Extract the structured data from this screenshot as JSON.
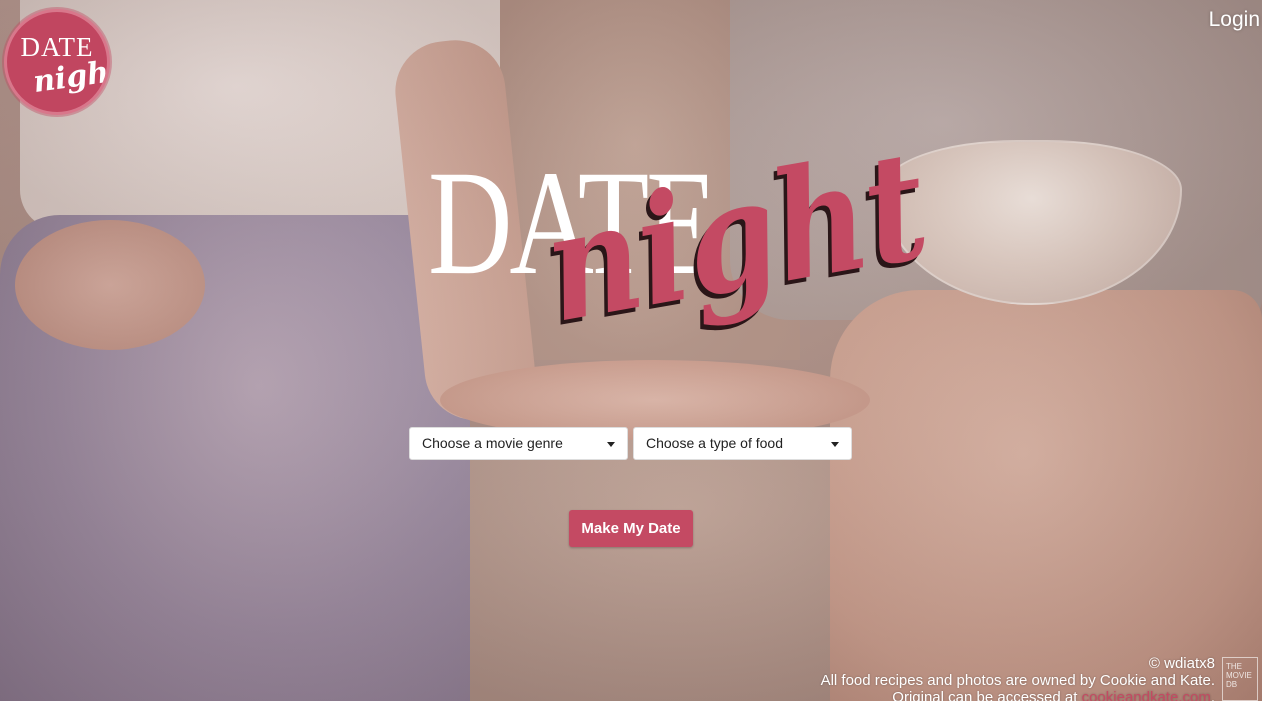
{
  "brand": {
    "badge_line1": "DATE",
    "badge_line2": "night",
    "hero_line1": "DATE",
    "hero_line2": "night"
  },
  "header": {
    "login_label": "Login"
  },
  "form": {
    "genre_select": "Choose a movie genre",
    "food_select": "Choose a type of food",
    "submit_label": "Make My Date"
  },
  "footer": {
    "copyright": "© wdiatx8",
    "recipes_notice": "All food recipes and photos are owned by Cookie and Kate.",
    "original_prefix": "Original can be accessed at ",
    "original_link": "cookieandkate.com",
    "original_suffix": ".",
    "tmdb_logo": "THE MOVIE DB"
  },
  "colors": {
    "accent": "#c44a63",
    "badge": "#c14660",
    "text_light": "#ffffff"
  },
  "icons": {
    "select_caret": "caret-down-icon"
  }
}
